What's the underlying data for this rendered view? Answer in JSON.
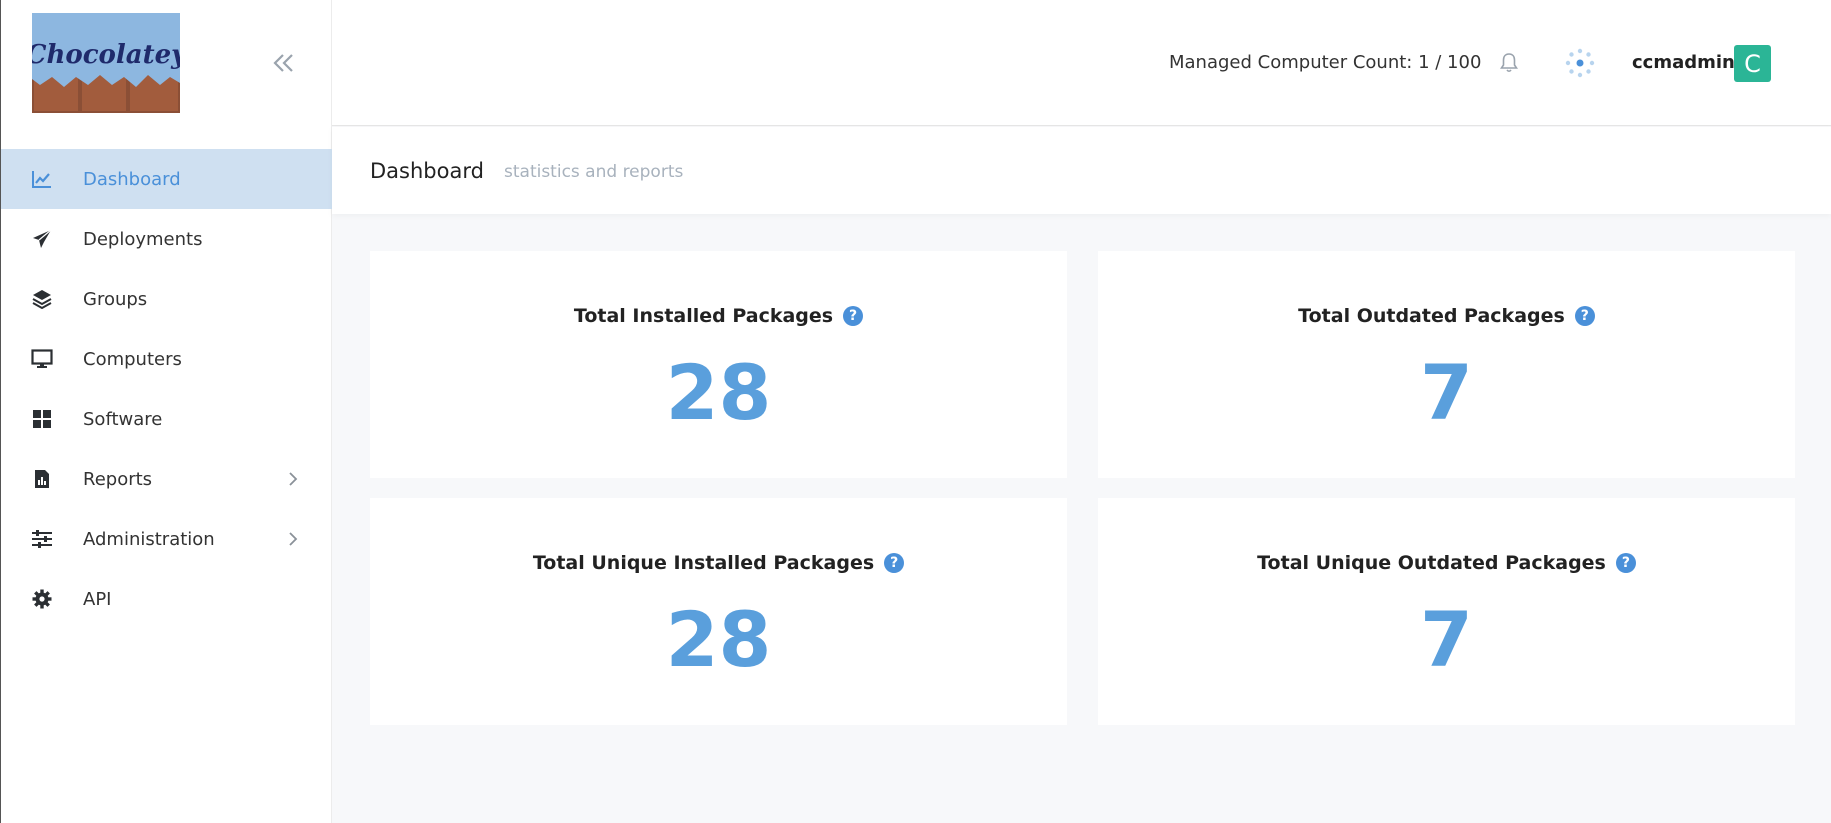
{
  "brand": {
    "logo_text": "Chocolatey"
  },
  "sidebar": {
    "items": [
      {
        "label": "Dashboard",
        "icon": "chart-line-icon"
      },
      {
        "label": "Deployments",
        "icon": "paper-plane-icon"
      },
      {
        "label": "Groups",
        "icon": "layers-icon"
      },
      {
        "label": "Computers",
        "icon": "desktop-icon"
      },
      {
        "label": "Software",
        "icon": "grid-icon"
      },
      {
        "label": "Reports",
        "icon": "report-icon"
      },
      {
        "label": "Administration",
        "icon": "sliders-icon"
      },
      {
        "label": "API",
        "icon": "gear-icon"
      }
    ]
  },
  "topbar": {
    "managed_computer_count": "Managed Computer Count: 1 / 100",
    "username": "ccmadmin",
    "avatar_letter": "C"
  },
  "page": {
    "title": "Dashboard",
    "subtitle": "statistics and reports"
  },
  "cards": [
    {
      "title": "Total Installed Packages",
      "value": "28"
    },
    {
      "title": "Total Outdated Packages",
      "value": "7"
    },
    {
      "title": "Total Unique Installed Packages",
      "value": "28"
    },
    {
      "title": "Total Unique Outdated Packages",
      "value": "7"
    }
  ],
  "colors": {
    "accent": "#4a90d9",
    "value": "#5a9fdc",
    "active_bg": "#cfe0f1",
    "avatar": "#2bb596"
  }
}
